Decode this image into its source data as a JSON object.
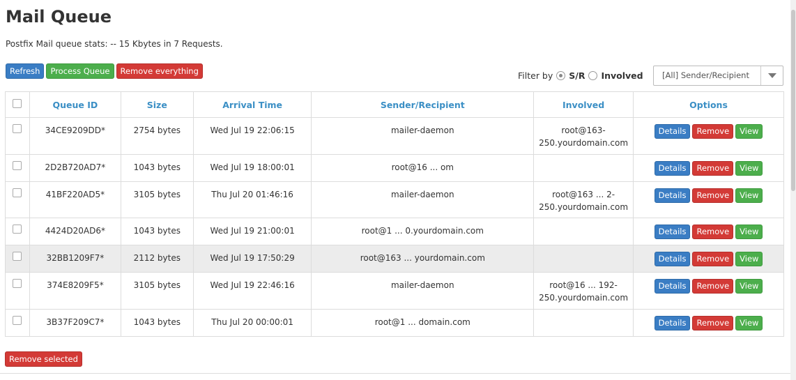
{
  "page": {
    "title": "Mail Queue",
    "stats": "Postfix Mail queue stats: -- 15 Kbytes in 7 Requests."
  },
  "toolbar": {
    "refresh": "Refresh",
    "process_queue": "Process Queue",
    "remove_everything": "Remove everything"
  },
  "filter": {
    "label": "Filter by",
    "option_sr": "S/R",
    "option_involved": "Involved",
    "selected": "S/R",
    "select_value": "[All] Sender/Recipient"
  },
  "table": {
    "headers": {
      "queue_id": "Queue ID",
      "size": "Size",
      "arrival": "Arrival Time",
      "sender": "Sender/Recipient",
      "involved": "Involved",
      "options": "Options"
    },
    "rows": [
      {
        "id": "34CE9209DD*",
        "size": "2754 bytes",
        "arrival": "Wed Jul 19 22:06:15",
        "sender": "mailer-daemon",
        "involved_a": "root@163-",
        "involved_b": "250.yourdomain.com"
      },
      {
        "id": "2D2B720AD7*",
        "size": "1043 bytes",
        "arrival": "Wed Jul 19 18:00:01",
        "sender": "root@16 ... om",
        "involved_a": "",
        "involved_b": ""
      },
      {
        "id": "41BF220AD5*",
        "size": "3105 bytes",
        "arrival": "Thu Jul 20 01:46:16",
        "sender": "mailer-daemon",
        "involved_a": "root@163 ... 2-",
        "involved_b": "250.yourdomain.com"
      },
      {
        "id": "4424D20AD6*",
        "size": "1043 bytes",
        "arrival": "Wed Jul 19 21:00:01",
        "sender": "root@1 ... 0.yourdomain.com",
        "involved_a": "",
        "involved_b": ""
      },
      {
        "id": "32BB1209F7*",
        "size": "2112 bytes",
        "arrival": "Wed Jul 19 17:50:29",
        "sender": "root@163 ... yourdomain.com",
        "involved_a": "",
        "involved_b": ""
      },
      {
        "id": "374E8209F5*",
        "size": "3105 bytes",
        "arrival": "Wed Jul 19 22:46:16",
        "sender": "mailer-daemon",
        "involved_a": "root@16 ... 192-",
        "involved_b": "250.yourdomain.com"
      },
      {
        "id": "3B37F209C7*",
        "size": "1043 bytes",
        "arrival": "Thu Jul 20 00:00:01",
        "sender": "root@1 ... domain.com",
        "involved_a": "",
        "involved_b": ""
      }
    ],
    "actions": {
      "details": "Details",
      "remove": "Remove",
      "view": "View"
    }
  },
  "footer": {
    "remove_selected": "Remove selected"
  },
  "colors": {
    "header_text": "#3b8fc5",
    "blue": "#3a7dc4",
    "green": "#4cae4c",
    "red": "#d33a36",
    "highlight_row": "#ececec"
  }
}
